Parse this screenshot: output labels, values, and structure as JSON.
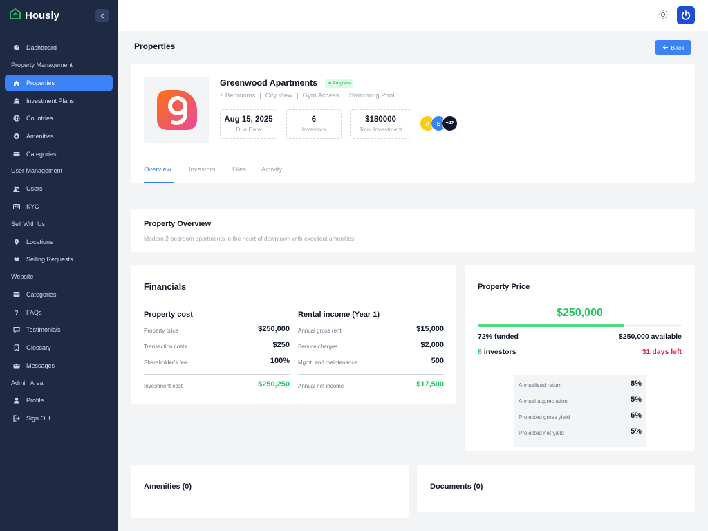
{
  "app": {
    "name": "Hously"
  },
  "sidebar": {
    "sections": [
      {
        "title": "",
        "items": [
          {
            "label": "Dashboard",
            "icon": "dashboard-icon",
            "active": false
          }
        ]
      },
      {
        "title": "Property Management",
        "items": [
          {
            "label": "Properties",
            "icon": "home-icon",
            "active": true
          },
          {
            "label": "Investment Plans",
            "icon": "bank-icon",
            "active": false
          },
          {
            "label": "Countries",
            "icon": "globe-icon",
            "active": false
          },
          {
            "label": "Amenities",
            "icon": "amenity-icon",
            "active": false
          },
          {
            "label": "Categories",
            "icon": "category-icon",
            "active": false
          }
        ]
      },
      {
        "title": "User Management",
        "items": [
          {
            "label": "Users",
            "icon": "users-icon",
            "active": false
          },
          {
            "label": "KYC",
            "icon": "id-card-icon",
            "active": false
          }
        ]
      },
      {
        "title": "Sell With Us",
        "items": [
          {
            "label": "Locations",
            "icon": "pin-icon",
            "active": false
          },
          {
            "label": "Selling Requests",
            "icon": "handshake-icon",
            "active": false
          }
        ]
      },
      {
        "title": "Website",
        "items": [
          {
            "label": "Categories",
            "icon": "category-icon",
            "active": false
          },
          {
            "label": "FAQs",
            "icon": "question-icon",
            "active": false
          },
          {
            "label": "Testimonials",
            "icon": "chat-icon",
            "active": false
          },
          {
            "label": "Glossary",
            "icon": "bookmark-icon",
            "active": false
          },
          {
            "label": "Messages",
            "icon": "mail-icon",
            "active": false
          }
        ]
      },
      {
        "title": "Admin Area",
        "items": [
          {
            "label": "Profile",
            "icon": "user-icon",
            "active": false
          },
          {
            "label": "Sign Out",
            "icon": "sign-out-icon",
            "active": false
          }
        ]
      }
    ]
  },
  "header": {
    "page_title": "Properties",
    "back_label": "Back"
  },
  "property": {
    "name": "Greenwood Apartments",
    "status": "In Progress",
    "features": [
      "2 Bedrooms",
      "City View",
      "Gym Access",
      "Swimming Pool"
    ],
    "stats": [
      {
        "value": "Aug 15, 2025",
        "label": "Due Date"
      },
      {
        "value": "6",
        "label": "Investors"
      },
      {
        "value": "$180000",
        "label": "Totol Investment"
      }
    ],
    "avatars": [
      {
        "text": "A",
        "color": "#facc15"
      },
      {
        "text": "S",
        "color": "#3b82f6"
      },
      {
        "text": "+42",
        "color": "#0f172a"
      }
    ],
    "tabs": [
      "Overview",
      "Investors",
      "Files",
      "Activity"
    ],
    "active_tab": "Overview"
  },
  "overview": {
    "title": "Property Overview",
    "description": "Modern 2-bedroom apartments in the heart of downtown with excellent amenities."
  },
  "financials": {
    "title": "Financials",
    "cost": {
      "title": "Property cost",
      "rows": [
        {
          "label": "Property price",
          "value": "$250,000"
        },
        {
          "label": "Transaction costs",
          "value": "$250"
        },
        {
          "label": "Shareholder's fee",
          "value": "100%"
        }
      ],
      "total_label": "Investment cost",
      "total_value": "$250,250"
    },
    "income": {
      "title": "Rental income (Year 1)",
      "rows": [
        {
          "label": "Annual gross rent",
          "value": "$15,000"
        },
        {
          "label": "Service charges",
          "value": "$2,000"
        },
        {
          "label": "Mgmt. and maintenance",
          "value": "500"
        }
      ],
      "total_label": "Annual net income",
      "total_value": "$17,500"
    }
  },
  "price": {
    "title": "Property Price",
    "amount": "$250,000",
    "funded_fraction": 0.72,
    "funded_label": "72% funded",
    "available_label": "$250,000 available",
    "investors_count": "6",
    "investors_label": "investors",
    "days_left": "31 days left",
    "yields": [
      {
        "label": "Annualised return",
        "value": "8%"
      },
      {
        "label": "Annual appreciation",
        "value": "5%"
      },
      {
        "label": "Projected gross yield",
        "value": "6%"
      },
      {
        "label": "Projected net yield",
        "value": "5%"
      }
    ]
  },
  "amenities": {
    "title": "Amenities (0)"
  },
  "documents": {
    "title": "Documents (0)"
  },
  "colors": {
    "accent": "#3b82f6",
    "sidebar": "#1e2a44",
    "success": "#22c55e",
    "danger": "#e11d48"
  }
}
